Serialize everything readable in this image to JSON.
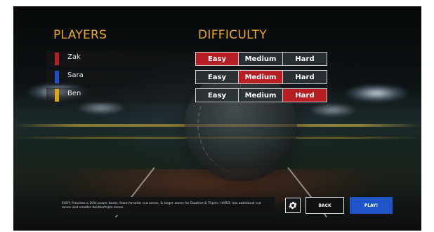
{
  "headers": {
    "players": "PLAYERS",
    "difficulty": "DIFFICULTY"
  },
  "players": [
    {
      "name": "Zak",
      "color": "#b81f25",
      "difficulty": "Easy"
    },
    {
      "name": "Sara",
      "color": "#1e4fc4",
      "difficulty": "Medium"
    },
    {
      "name": "Ben",
      "color": "#d9a614",
      "difficulty": "Hard"
    }
  ],
  "difficulty_options": [
    "Easy",
    "Medium",
    "Hard"
  ],
  "footer": {
    "description": "EASY: Provides a 20% power boost, fewer/smaller out zones, & larger zones for Doubles & Triples. HARD: has additional out zones and smaller double/triple zones.",
    "settings_icon": "gear-icon",
    "back_label": "BACK",
    "play_label": "PLAY!"
  },
  "colors": {
    "accent_orange": "#f0a820",
    "selected_red": "#b81f25",
    "play_blue": "#1f55c8"
  }
}
